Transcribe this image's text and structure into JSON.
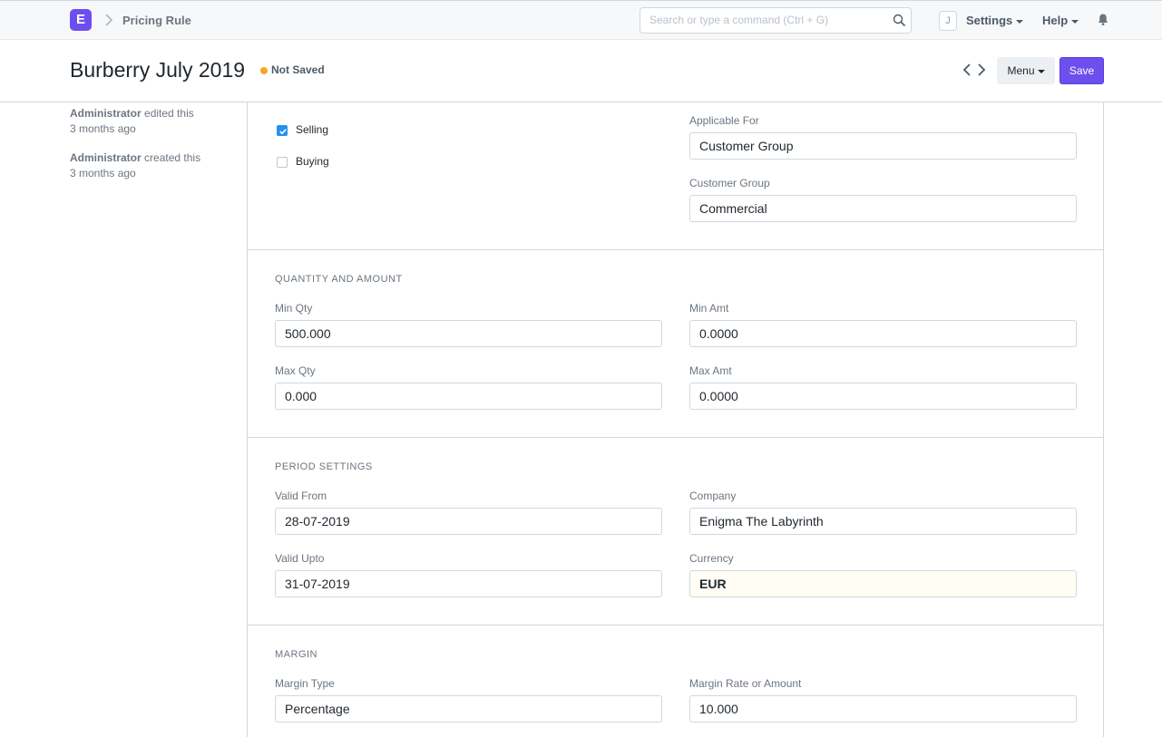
{
  "navbar": {
    "logo_letter": "E",
    "breadcrumb": "Pricing Rule",
    "search_placeholder": "Search or type a command (Ctrl + G)",
    "avatar_initial": "J",
    "settings_label": "Settings",
    "help_label": "Help"
  },
  "header": {
    "title": "Burberry July 2019",
    "status": "Not Saved",
    "status_color": "#f5a623",
    "menu_label": "Menu",
    "save_label": "Save"
  },
  "timeline": [
    {
      "user": "Administrator",
      "action": "edited this",
      "when": "3 months ago"
    },
    {
      "user": "Administrator",
      "action": "created this",
      "when": "3 months ago"
    }
  ],
  "form": {
    "applicability": {
      "selling_label": "Selling",
      "selling_checked": true,
      "buying_label": "Buying",
      "buying_checked": false,
      "applicable_for_label": "Applicable For",
      "applicable_for_value": "Customer Group",
      "customer_group_label": "Customer Group",
      "customer_group_value": "Commercial"
    },
    "quantity": {
      "heading": "QUANTITY AND AMOUNT",
      "min_qty_label": "Min Qty",
      "min_qty_value": "500.000",
      "min_amt_label": "Min Amt",
      "min_amt_value": "0.0000",
      "max_qty_label": "Max Qty",
      "max_qty_value": "0.000",
      "max_amt_label": "Max Amt",
      "max_amt_value": "0.0000"
    },
    "period": {
      "heading": "PERIOD SETTINGS",
      "valid_from_label": "Valid From",
      "valid_from_value": "28-07-2019",
      "company_label": "Company",
      "company_value": "Enigma The Labyrinth",
      "valid_upto_label": "Valid Upto",
      "valid_upto_value": "31-07-2019",
      "currency_label": "Currency",
      "currency_value": "EUR"
    },
    "margin": {
      "heading": "MARGIN",
      "margin_type_label": "Margin Type",
      "margin_type_value": "Percentage",
      "margin_rate_label": "Margin Rate or Amount",
      "margin_rate_value": "10.000"
    }
  },
  "colors": {
    "brand": "#6d4fee",
    "checkbox_checked": "#2490ef"
  }
}
